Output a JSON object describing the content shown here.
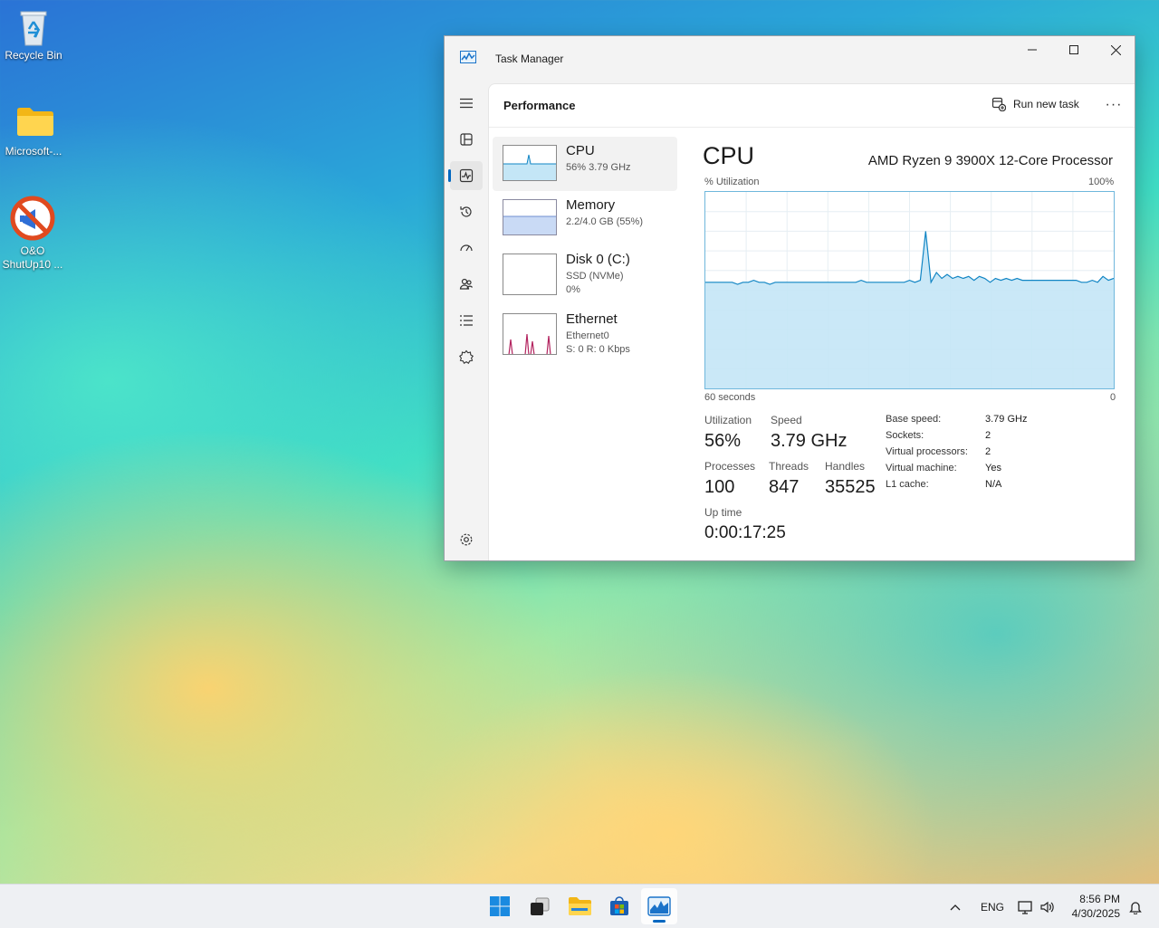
{
  "desktop": {
    "icons": [
      {
        "label": "Recycle Bin"
      },
      {
        "label": "Microsoft-..."
      },
      {
        "label_line1": "O&O",
        "label_line2": "ShutUp10 ..."
      }
    ]
  },
  "window": {
    "title": "Task Manager",
    "page_title": "Performance",
    "run_new_task": "Run new task",
    "more_glyph": "···",
    "nav_icons": [
      "hamburger-icon",
      "processes-icon",
      "performance-icon",
      "app-history-icon",
      "startup-icon",
      "users-icon",
      "details-icon",
      "services-icon",
      "settings-icon"
    ]
  },
  "perf_list": [
    {
      "name": "CPU",
      "sub1": "56% 3.79 GHz",
      "sub2": ""
    },
    {
      "name": "Memory",
      "sub1": "2.2/4.0 GB (55%)",
      "sub2": ""
    },
    {
      "name": "Disk 0 (C:)",
      "sub1": "SSD (NVMe)",
      "sub2": "0%"
    },
    {
      "name": "Ethernet",
      "sub1": "Ethernet0",
      "sub2": "S: 0 R: 0 Kbps"
    }
  ],
  "cpu": {
    "title": "CPU",
    "model": "AMD Ryzen 9 3900X 12-Core Processor",
    "graph_label_left": "% Utilization",
    "graph_label_right": "100%",
    "axis_left": "60 seconds",
    "axis_right": "0",
    "stats": {
      "utilization_label": "Utilization",
      "utilization": "56%",
      "speed_label": "Speed",
      "speed": "3.79 GHz",
      "processes_label": "Processes",
      "processes": "100",
      "threads_label": "Threads",
      "threads": "847",
      "handles_label": "Handles",
      "handles": "35525",
      "uptime_label": "Up time",
      "uptime": "0:00:17:25"
    },
    "details": [
      {
        "label": "Base speed:",
        "value": "3.79 GHz"
      },
      {
        "label": "Sockets:",
        "value": "2"
      },
      {
        "label": "Virtual processors:",
        "value": "2"
      },
      {
        "label": "Virtual machine:",
        "value": "Yes"
      },
      {
        "label": "L1 cache:",
        "value": "N/A"
      }
    ],
    "utilization_history": [
      54,
      54,
      54,
      54,
      54,
      54,
      53,
      54,
      54,
      55,
      54,
      54,
      53,
      54,
      54,
      54,
      54,
      54,
      54,
      54,
      54,
      54,
      54,
      54,
      54,
      54,
      54,
      54,
      54,
      55,
      54,
      54,
      54,
      54,
      54,
      54,
      54,
      54,
      55,
      54,
      55,
      80,
      54,
      59,
      56,
      58,
      56,
      57,
      56,
      57,
      55,
      57,
      56,
      54,
      56,
      55,
      56,
      55,
      56,
      55,
      55,
      55,
      55,
      55,
      55,
      55,
      55,
      55,
      55,
      55,
      54,
      54,
      55,
      54,
      57,
      55,
      56
    ],
    "accent_color": "#1185c4",
    "fill_color": "#c4e6f6"
  },
  "taskbar": {
    "apps": [
      "start-icon",
      "task-view-icon",
      "file-explorer-icon",
      "store-icon",
      "task-manager-icon"
    ],
    "lang": "ENG",
    "time": "8:56 PM",
    "date": "4/30/2025"
  }
}
